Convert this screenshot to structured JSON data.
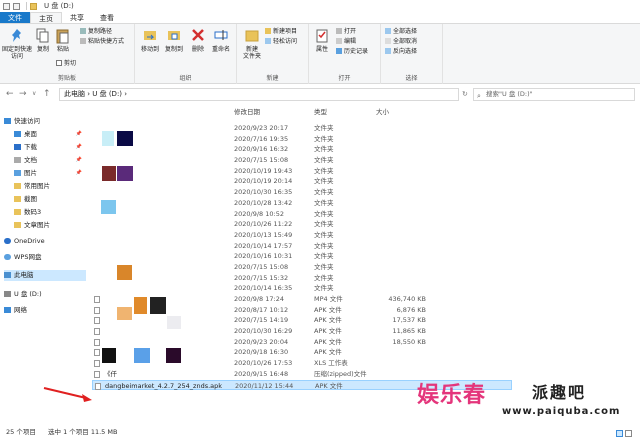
{
  "window": {
    "title": "U 盘 (D:)"
  },
  "tabs": [
    "文件",
    "主页",
    "共享",
    "查看"
  ],
  "ribbon": {
    "clipboard": {
      "label": "剪贴板",
      "pin": "固定到快速访问",
      "copy": "复制",
      "paste": "粘贴",
      "cut": "剪切",
      "copy_path": "复制路径",
      "paste_shortcut": "粘贴快捷方式"
    },
    "organize": {
      "label": "组织",
      "move_to": "移动到",
      "copy_to": "复制到",
      "delete": "删除",
      "rename": "重命名"
    },
    "new": {
      "label": "新建",
      "new_folder": "新建\n文件夹",
      "new_item": "新建项目",
      "easy_access": "轻松访问"
    },
    "open": {
      "label": "打开",
      "properties": "属性",
      "open": "打开",
      "edit": "编辑",
      "history": "历史记录"
    },
    "select": {
      "label": "选择",
      "select_all": "全部选择",
      "select_none": "全部取消",
      "invert": "反向选择"
    }
  },
  "address": {
    "path": "此电脑  ›  U 盘 (D:)  ›",
    "search_placeholder": "搜索\"U 盘 (D:)\""
  },
  "nav": {
    "quick_access": "快速访问",
    "items": [
      {
        "label": "桌面",
        "pinned": true
      },
      {
        "label": "下载",
        "pinned": true
      },
      {
        "label": "文档",
        "pinned": true
      },
      {
        "label": "图片",
        "pinned": true
      },
      {
        "label": "常用图片",
        "pinned": false
      },
      {
        "label": "截图",
        "pinned": false
      },
      {
        "label": "数码3",
        "pinned": false
      },
      {
        "label": "文章图片",
        "pinned": false
      }
    ],
    "onedrive": "OneDrive",
    "wps": "WPS网盘",
    "this_pc": "此电脑",
    "udisk": "U 盘 (D:)",
    "network": "网络"
  },
  "columns": {
    "date": "修改日期",
    "type": "类型",
    "size": "大小"
  },
  "rows": [
    {
      "name": "",
      "date": "2020/9/23 20:17",
      "type": "文件夹",
      "size": ""
    },
    {
      "name": "",
      "date": "2020/7/16 19:35",
      "type": "文件夹",
      "size": ""
    },
    {
      "name": "",
      "date": "2020/9/16 16:32",
      "type": "文件夹",
      "size": ""
    },
    {
      "name": "",
      "date": "2020/7/15 15:08",
      "type": "文件夹",
      "size": ""
    },
    {
      "name": "",
      "date": "2020/10/19 19:43",
      "type": "文件夹",
      "size": ""
    },
    {
      "name": "",
      "date": "2020/10/19 20:14",
      "type": "文件夹",
      "size": ""
    },
    {
      "name": "",
      "date": "2020/10/30 16:35",
      "type": "文件夹",
      "size": ""
    },
    {
      "name": "",
      "date": "2020/10/28 13:42",
      "type": "文件夹",
      "size": ""
    },
    {
      "name": "",
      "date": "2020/9/8 10:52",
      "type": "文件夹",
      "size": ""
    },
    {
      "name": "",
      "date": "2020/10/26 11:22",
      "type": "文件夹",
      "size": ""
    },
    {
      "name": "",
      "date": "2020/10/13 15:49",
      "type": "文件夹",
      "size": ""
    },
    {
      "name": "",
      "date": "2020/10/14 17:57",
      "type": "文件夹",
      "size": ""
    },
    {
      "name": "",
      "date": "2020/10/16 10:31",
      "type": "文件夹",
      "size": ""
    },
    {
      "name": "",
      "date": "2020/7/15 15:08",
      "type": "文件夹",
      "size": ""
    },
    {
      "name": "",
      "date": "2020/7/15 15:32",
      "type": "文件夹",
      "size": ""
    },
    {
      "name": "",
      "date": "2020/10/14 16:35",
      "type": "文件夹",
      "size": ""
    },
    {
      "name": "",
      "date": "2020/9/8 17:24",
      "type": "MP4 文件",
      "size": "436,740 KB"
    },
    {
      "name": "",
      "date": "2020/8/17 10:12",
      "type": "APK 文件",
      "size": "6,876 KB"
    },
    {
      "name": "",
      "date": "2020/7/15 14:19",
      "type": "APK 文件",
      "size": "17,537 KB"
    },
    {
      "name": "",
      "date": "2020/10/30 16:29",
      "type": "APK 文件",
      "size": "11,865 KB"
    },
    {
      "name": "",
      "date": "2020/9/23 20:04",
      "type": "APK 文件",
      "size": "18,550 KB"
    },
    {
      "name": "",
      "date": "2020/9/18 16:30",
      "type": "APK 文件",
      "size": ""
    },
    {
      "name": "",
      "date": "2020/10/26 17:53",
      "type": "XLS 工作表",
      "size": ""
    },
    {
      "name": "《仟",
      "date": "2020/9/15 16:48",
      "type": "压缩(zipped)文件",
      "size": ""
    },
    {
      "name": "dangbeimarket_4.2.7_254_znds.apk",
      "date": "2020/11/12 15:44",
      "type": "APK 文件",
      "size": ""
    }
  ],
  "status": {
    "count": "25 个项目",
    "selected": "选中 1 个项目  11.5 MB"
  },
  "watermark": {
    "logo": "娱乐春",
    "right": "派趣吧",
    "url": "www.paiquba.com"
  }
}
